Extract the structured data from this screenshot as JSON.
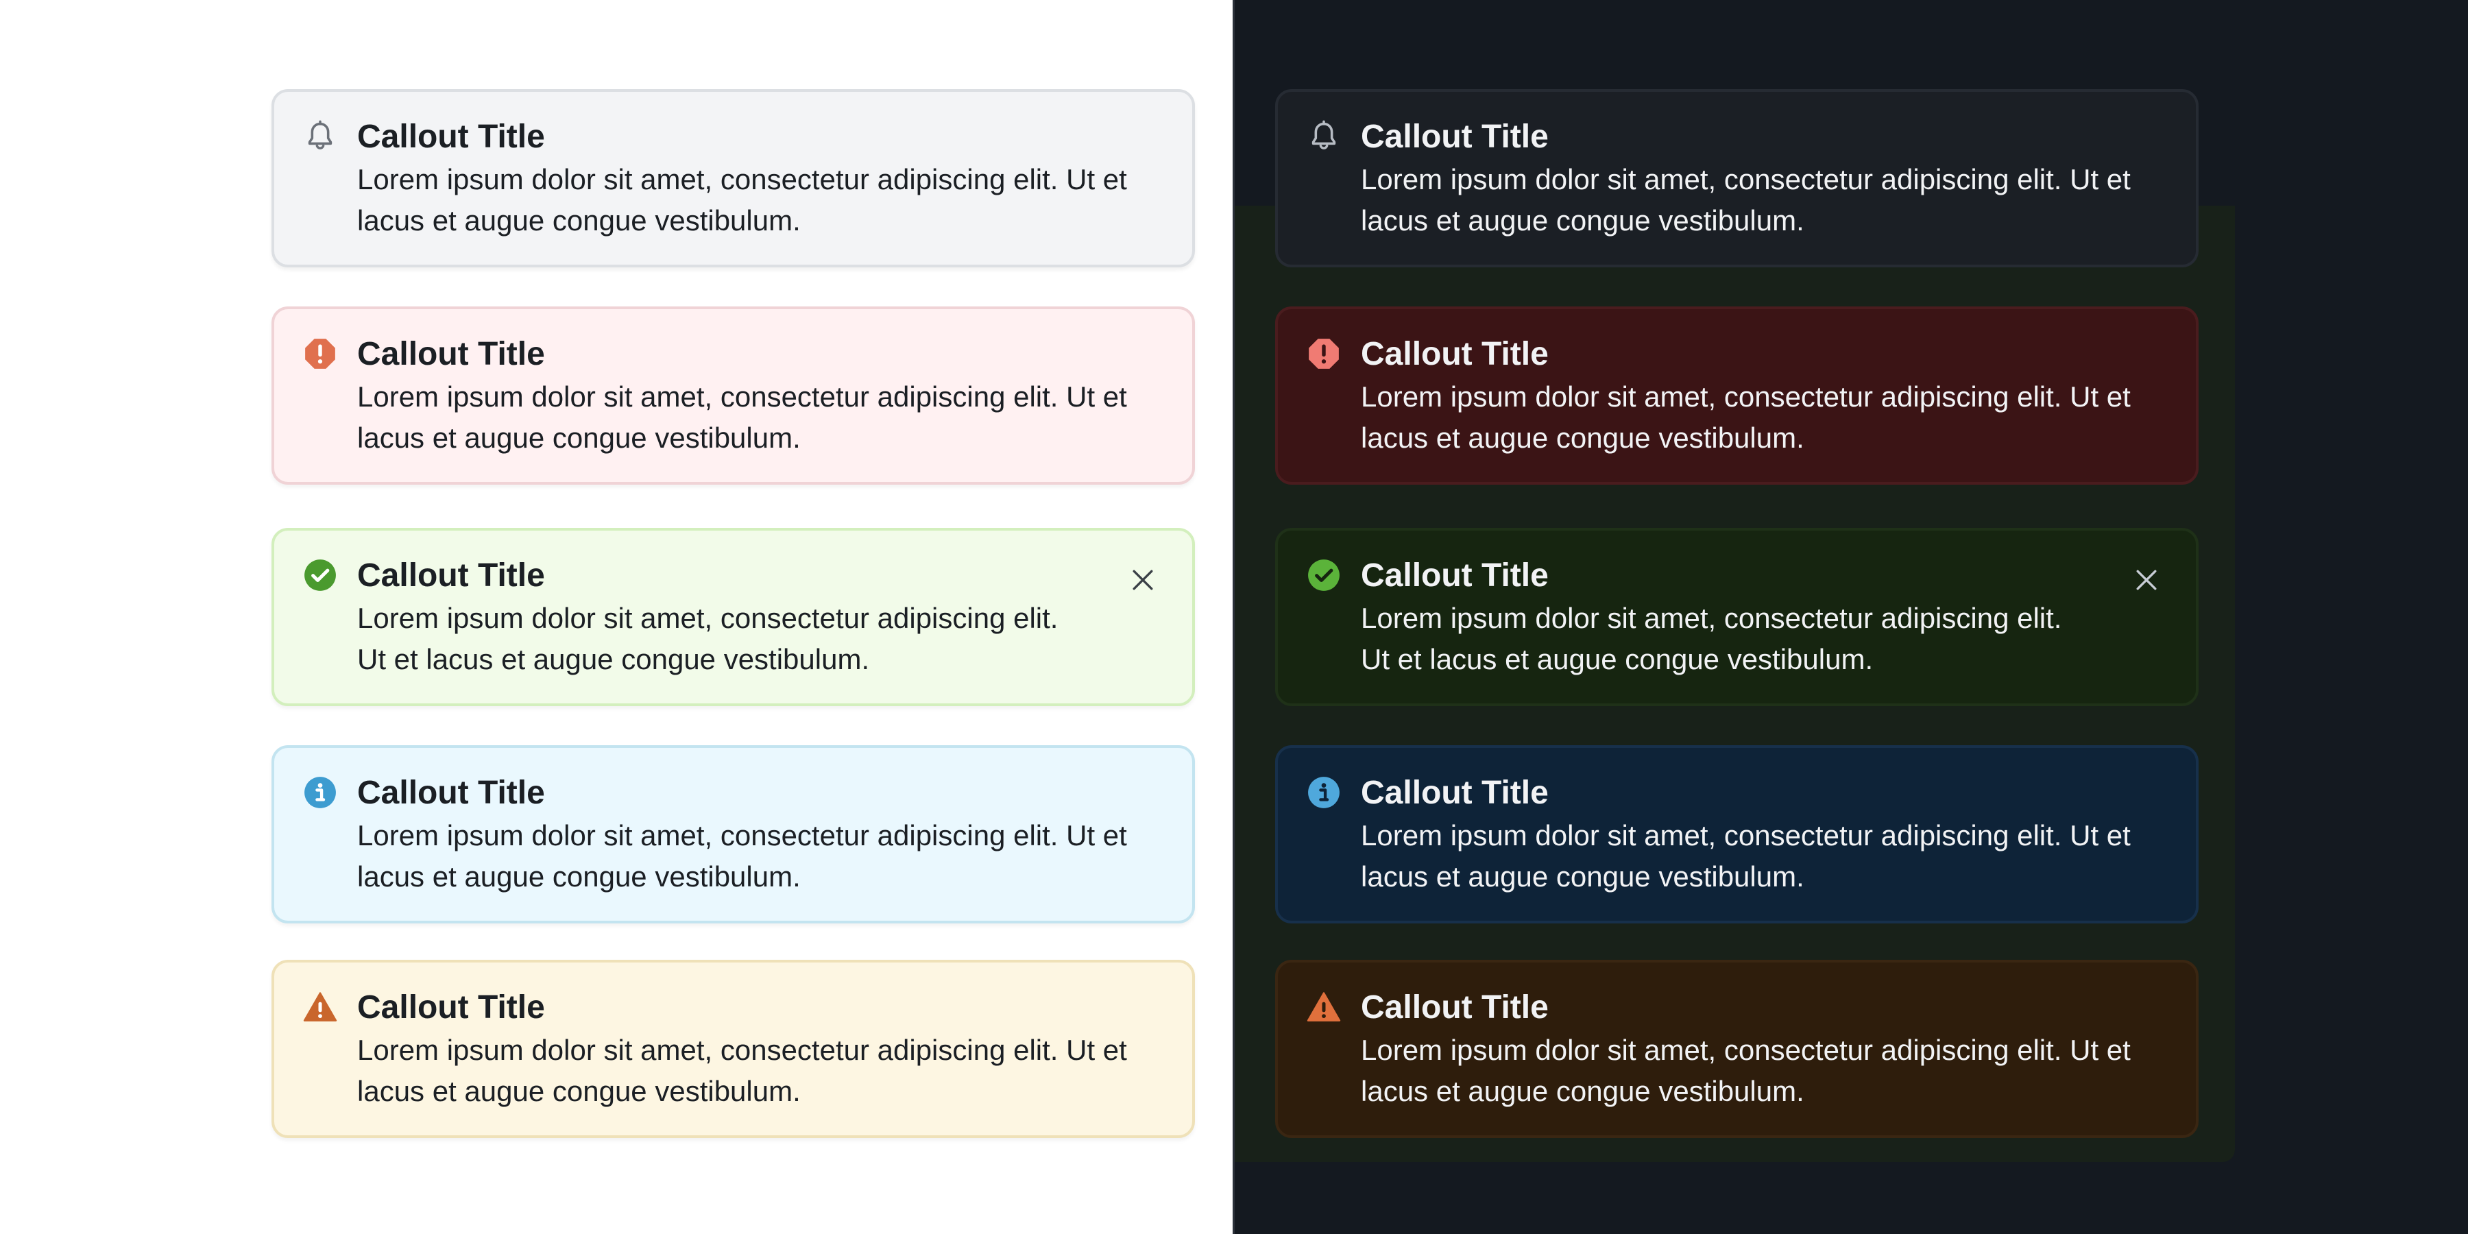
{
  "colors": {
    "light_bg": "#ffffff",
    "dark_bg": "#141920",
    "bell_icon": "#6b7078",
    "error_icon": "#e0704e",
    "success_icon": "#4a9a2e",
    "info_icon": "#3d9cd0",
    "warning_icon": "#c9662c"
  },
  "light_callouts": [
    {
      "variant": "neutral",
      "icon": "bell-icon",
      "title": "Callout Title",
      "body": "Lorem ipsum dolor sit amet, consectetur adipiscing elit. Ut et lacus et augue congue vestibulum."
    },
    {
      "variant": "error",
      "icon": "error-icon",
      "title": "Callout Title",
      "body": "Lorem ipsum dolor sit amet, consectetur adipiscing elit. Ut et lacus et augue congue vestibulum."
    },
    {
      "variant": "success",
      "icon": "check-circle-icon",
      "title": "Callout Title",
      "body": "Lorem ipsum dolor sit amet, consectetur adipiscing elit. Ut et lacus et augue congue vestibulum.",
      "dismissible": true
    },
    {
      "variant": "info",
      "icon": "info-icon",
      "title": "Callout Title",
      "body": "Lorem ipsum dolor sit amet, consectetur adipiscing elit. Ut et lacus et augue congue vestibulum."
    },
    {
      "variant": "warning",
      "icon": "warning-icon",
      "title": "Callout Title",
      "body": "Lorem ipsum dolor sit amet, consectetur adipiscing elit. Ut et lacus et augue congue vestibulum."
    }
  ],
  "dark_callouts": [
    {
      "variant": "neutral",
      "icon": "bell-icon",
      "title": "Callout Title",
      "body": "Lorem ipsum dolor sit amet, consectetur adipiscing elit. Ut et lacus et augue congue vestibulum."
    },
    {
      "variant": "error",
      "icon": "error-icon",
      "title": "Callout Title",
      "body": "Lorem ipsum dolor sit amet, consectetur adipiscing elit. Ut et lacus et augue congue vestibulum."
    },
    {
      "variant": "success",
      "icon": "check-circle-icon",
      "title": "Callout Title",
      "body": "Lorem ipsum dolor sit amet, consectetur adipiscing elit. Ut et lacus et augue congue vestibulum.",
      "dismissible": true
    },
    {
      "variant": "info",
      "icon": "info-icon",
      "title": "Callout Title",
      "body": "Lorem ipsum dolor sit amet, consectetur adipiscing elit. Ut et lacus et augue congue vestibulum."
    },
    {
      "variant": "warning",
      "icon": "warning-icon",
      "title": "Callout Title",
      "body": "Lorem ipsum dolor sit amet, consectetur adipiscing elit. Ut et lacus et augue congue vestibulum."
    }
  ]
}
